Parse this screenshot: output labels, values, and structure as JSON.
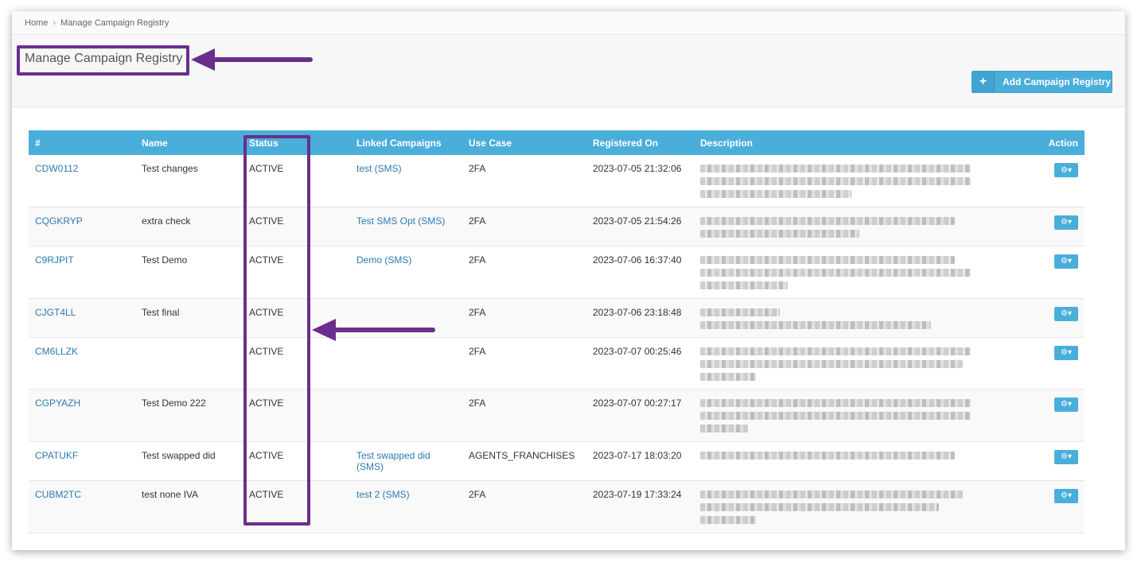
{
  "breadcrumb": {
    "home": "Home",
    "current": "Manage Campaign Registry"
  },
  "header": {
    "title": "Manage Campaign Registry",
    "add_button": "Add Campaign Registry"
  },
  "table": {
    "columns": [
      "#",
      "Name",
      "Status",
      "Linked Campaigns",
      "Use Case",
      "Registered On",
      "Description",
      "Action"
    ],
    "rows": [
      {
        "id": "CDW0112",
        "name": "Test  changes",
        "status": "ACTIVE",
        "linked": "test (SMS)",
        "use_case": "2FA",
        "registered": "2023-07-05 21:32:06"
      },
      {
        "id": "CQGKRYP",
        "name": "extra check",
        "status": "ACTIVE",
        "linked": "Test SMS Opt (SMS)",
        "use_case": "2FA",
        "registered": "2023-07-05 21:54:26"
      },
      {
        "id": "C9RJPIT",
        "name": "Test Demo",
        "status": "ACTIVE",
        "linked": "Demo (SMS)",
        "use_case": "2FA",
        "registered": "2023-07-06 16:37:40"
      },
      {
        "id": "CJGT4LL",
        "name": "Test final",
        "status": "ACTIVE",
        "linked": "",
        "use_case": "2FA",
        "registered": "2023-07-06 23:18:48"
      },
      {
        "id": "CM6LLZK",
        "name": "",
        "status": "ACTIVE",
        "linked": "",
        "use_case": "2FA",
        "registered": "2023-07-07 00:25:46"
      },
      {
        "id": "CGPYAZH",
        "name": "Test Demo 222",
        "status": "ACTIVE",
        "linked": "",
        "use_case": "2FA",
        "registered": "2023-07-07 00:27:17"
      },
      {
        "id": "CPATUKF",
        "name": "Test swapped did",
        "status": "ACTIVE",
        "linked": "Test swapped did (SMS)",
        "use_case": "AGENTS_FRANCHISES",
        "registered": "2023-07-17 18:03:20"
      },
      {
        "id": "CUBM2TC",
        "name": "test none IVA",
        "status": "ACTIVE",
        "linked": "test 2 (SMS)",
        "use_case": "2FA",
        "registered": "2023-07-19 17:33:24"
      }
    ]
  },
  "icons": {
    "add": "plus-icon",
    "action": "gear-dropdown-icon"
  },
  "colors": {
    "header_bg": "#4aaedb",
    "link": "#2a7ab0",
    "highlight": "#6a2e8c"
  }
}
